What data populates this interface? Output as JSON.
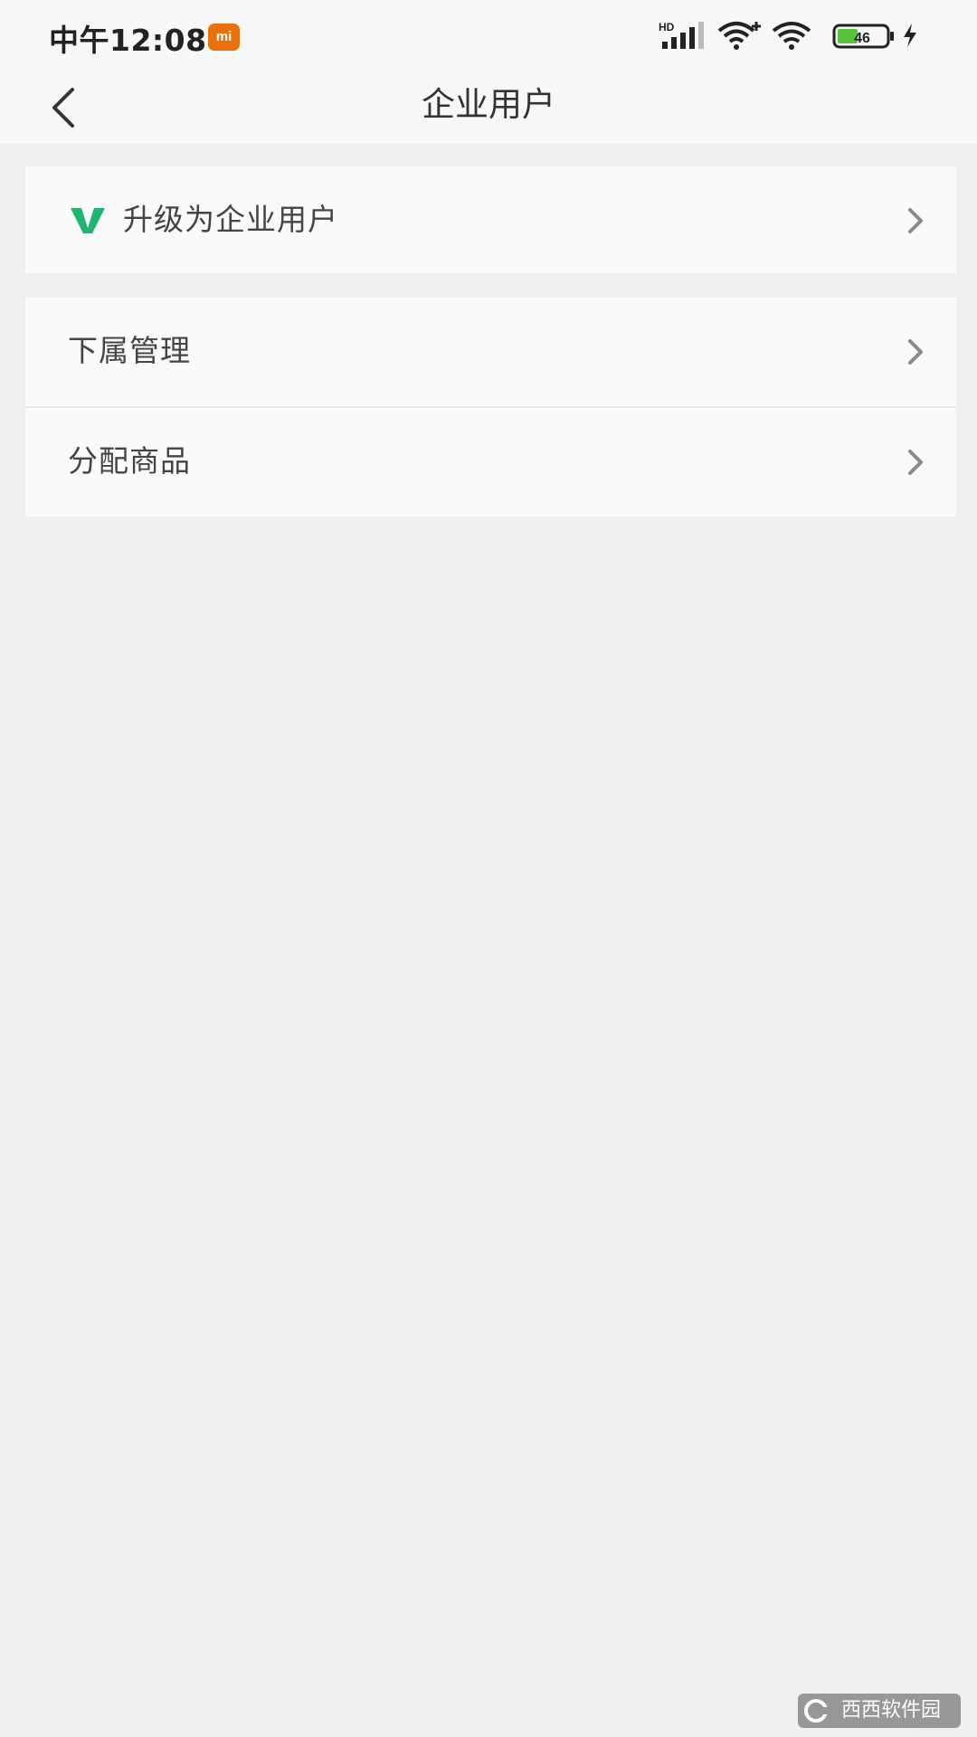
{
  "status_bar": {
    "time": "中午12:08",
    "badge": "mi",
    "network_label": "HD",
    "battery_level": "46",
    "icons": [
      "hd-signal-icon",
      "wifi-plus-icon",
      "wifi-icon",
      "battery-icon",
      "charging-icon"
    ]
  },
  "nav": {
    "title": "企业用户",
    "back_icon": "back-arrow-icon"
  },
  "upgrade": {
    "label": "升级为企业用户",
    "icon": "v-badge-icon",
    "icon_color": "#1fb56f"
  },
  "menu": {
    "items": [
      {
        "label": "下属管理"
      },
      {
        "label": "分配商品"
      }
    ]
  },
  "watermark": {
    "text": "西西软件园"
  },
  "colors": {
    "background": "#efefef",
    "card": "#fafafa",
    "text": "#444444",
    "chevron": "#8a8a8a",
    "accent": "#1fb56f",
    "mi_badge": "#e8710a"
  }
}
